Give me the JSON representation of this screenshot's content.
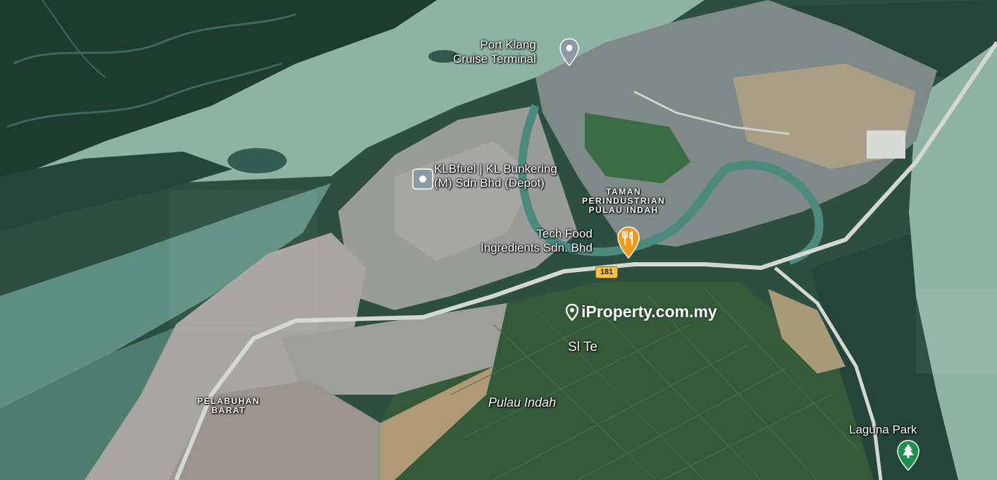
{
  "map": {
    "watermark": "iProperty.com.my",
    "places": {
      "cruise_terminal": "Port Klang\nCruise Terminal",
      "klbfuel": "KLBfuel | KL Bunkering\n(M) Sdn Bhd (Depot)",
      "tech_food": "Tech Food\nIngredients Sdn. Bhd",
      "laguna_park": "Laguna Park"
    },
    "areas": {
      "taman_perindustrian": "TAMAN\nPERINDUSTRIAN\nPULAU INDAH",
      "pelabuhan_barat": "PELABUHAN\nBARAT",
      "pulau_indah": "Pulau Indah",
      "sl_te": "Sl Te"
    },
    "road_shield": "181",
    "colors": {
      "water": "#7fa897",
      "mangrove": "#27483b",
      "industrial": "#8d9296",
      "road": "#c9ccc6",
      "restaurant_marker": "#f29a1e",
      "park_marker": "#1e8f4e",
      "generic_marker": "#8a9aa6"
    },
    "icons": {
      "cruise_terminal": "pin-icon",
      "klbfuel": "square-pin-icon",
      "tech_food": "restaurant-icon",
      "laguna_park": "tree-icon"
    }
  }
}
